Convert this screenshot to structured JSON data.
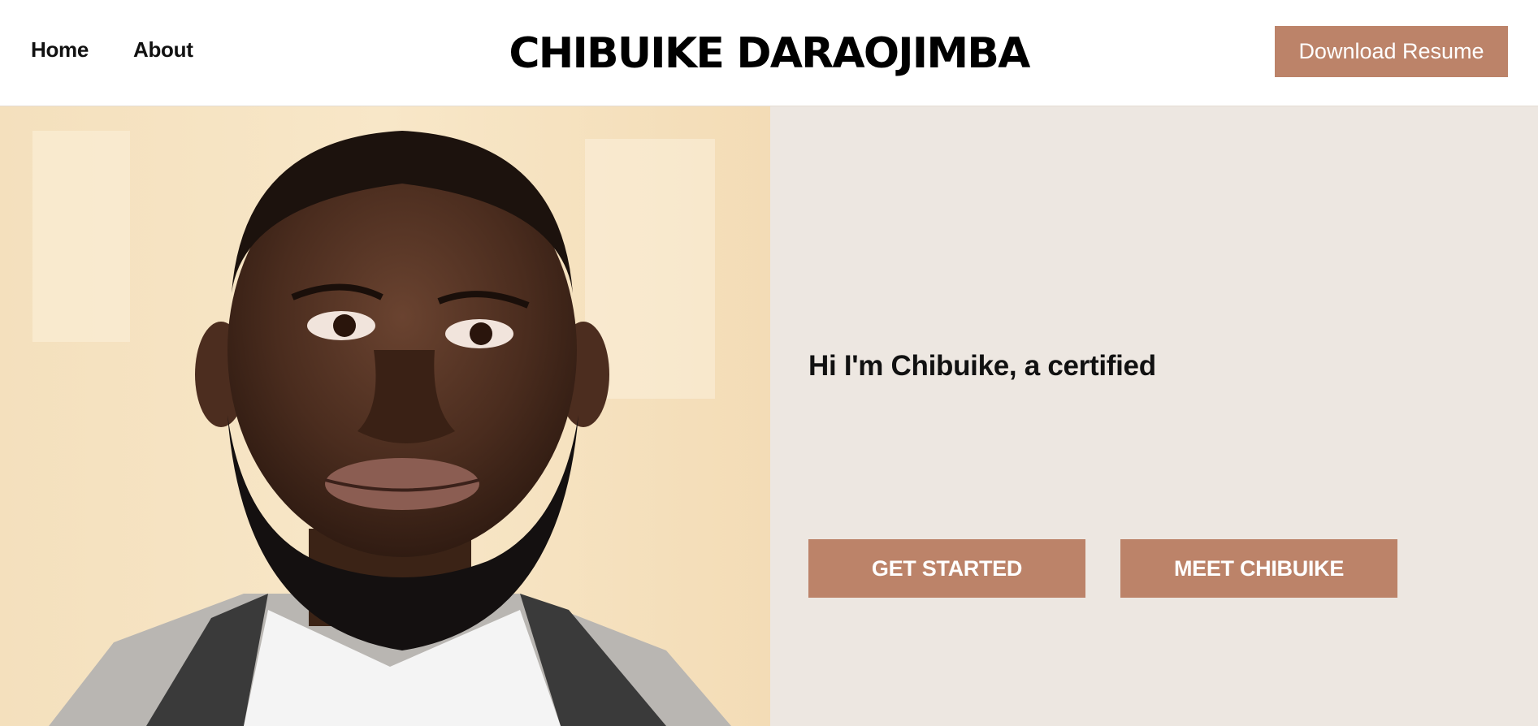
{
  "header": {
    "nav": [
      {
        "label": "Home"
      },
      {
        "label": "About"
      }
    ],
    "site_title": "CHIBUIKE DARAOJIMBA",
    "resume_button": "Download Resume"
  },
  "hero": {
    "intro": "Hi I'm Chibuike, a certified",
    "buttons": {
      "get_started": "GET STARTED",
      "meet": "MEET CHIBUIKE"
    }
  },
  "colors": {
    "accent": "#bc8369",
    "panel_bg": "#ede7e1",
    "text": "#111111"
  }
}
